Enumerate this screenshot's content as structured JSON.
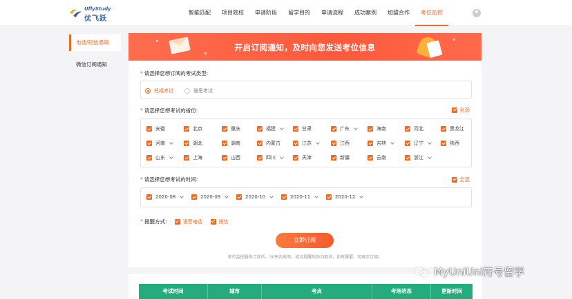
{
  "brand": {
    "logo_en": "UflyStudy",
    "logo_cn": "优飞跃"
  },
  "nav": {
    "items": [
      {
        "label": "智能匹配",
        "active": false
      },
      {
        "label": "项目院校",
        "active": false
      },
      {
        "label": "申请阶段",
        "active": false
      },
      {
        "label": "留学目的",
        "active": false
      },
      {
        "label": "申请流程",
        "active": false
      },
      {
        "label": "成功案例",
        "active": false
      },
      {
        "label": "加盟合作",
        "active": false
      },
      {
        "label": "考位监控",
        "active": true
      }
    ]
  },
  "sidebar": {
    "items": [
      {
        "label": "电话/短信通知",
        "active": true
      },
      {
        "label": "微信订阅通知",
        "active": false
      }
    ]
  },
  "banner": {
    "title": "开启订阅通知，及时向您发送考位信息"
  },
  "exam_type": {
    "question": "请选择您想订阅的考试类型:",
    "options": [
      {
        "label": "托福考试",
        "selected": true
      },
      {
        "label": "雅思考试",
        "selected": false
      }
    ]
  },
  "province": {
    "question": "请选择您想考试的省份:",
    "select_all": "全选",
    "rows": [
      [
        {
          "label": "安徽",
          "dd": false
        },
        {
          "label": "北京",
          "dd": false
        },
        {
          "label": "重庆",
          "dd": false
        },
        {
          "label": "福建",
          "dd": true
        },
        {
          "label": "甘肃",
          "dd": false
        },
        {
          "label": "广东",
          "dd": true
        },
        {
          "label": "海南",
          "dd": false
        },
        {
          "label": "河北",
          "dd": false
        },
        {
          "label": "黑龙江",
          "dd": false
        }
      ],
      [
        {
          "label": "河南",
          "dd": true
        },
        {
          "label": "湖北",
          "dd": false
        },
        {
          "label": "湖南",
          "dd": false
        },
        {
          "label": "内蒙古",
          "dd": false
        },
        {
          "label": "江苏",
          "dd": true
        },
        {
          "label": "江西",
          "dd": false
        },
        {
          "label": "吉林",
          "dd": true
        },
        {
          "label": "辽宁",
          "dd": true
        },
        {
          "label": "陕西",
          "dd": false
        }
      ],
      [
        {
          "label": "山东",
          "dd": true
        },
        {
          "label": "上海",
          "dd": false
        },
        {
          "label": "山西",
          "dd": false
        },
        {
          "label": "四川",
          "dd": true
        },
        {
          "label": "天津",
          "dd": false
        },
        {
          "label": "新疆",
          "dd": false
        },
        {
          "label": "云南",
          "dd": false
        },
        {
          "label": "浙江",
          "dd": true
        }
      ]
    ]
  },
  "exam_time": {
    "question": "请选择您想考试的时间:",
    "select_all": "全选",
    "months": [
      "2020-08",
      "2020-09",
      "2020-10",
      "2020-11",
      "2020-12"
    ]
  },
  "remind": {
    "label": "提醒方式：",
    "options": [
      "语音电话",
      "短信"
    ]
  },
  "subscribe_button": "立即订阅",
  "note": "考位监控服务订阅后，30天内有效。成功提醒后自动取消，如有需要，可再次订阅。",
  "table": {
    "headers": [
      "考试时间",
      "城市",
      "考点",
      "考场状态",
      "更新时间"
    ]
  },
  "watermark": "MyUniUni符号留学",
  "colors": {
    "accent": "#f26b25",
    "banner": "#fb5a3c",
    "table_header": "#24ac7e"
  }
}
